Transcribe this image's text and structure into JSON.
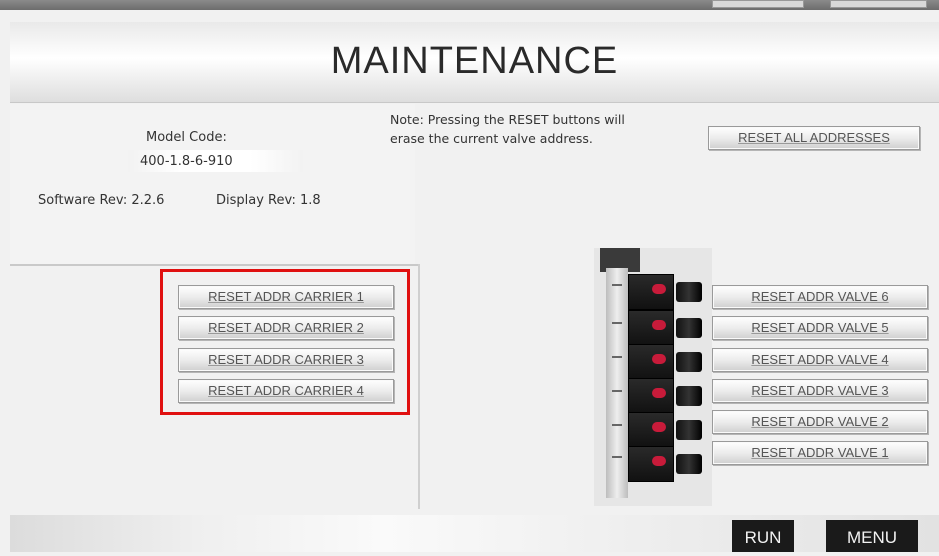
{
  "header": {
    "title": "MAINTENANCE"
  },
  "info": {
    "model_code_label": "Model Code:",
    "model_code_value": "400-1.8-6-910",
    "software_rev": "Software Rev: 2.2.6",
    "display_rev": "Display Rev: 1.8"
  },
  "note": {
    "line1": "Note: Pressing the RESET buttons will",
    "line2": "erase the current valve address."
  },
  "reset_all_label": "RESET ALL ADDRESSES",
  "carrier_buttons": [
    "RESET ADDR CARRIER 1",
    "RESET ADDR CARRIER 2",
    "RESET ADDR CARRIER 3",
    "RESET ADDR CARRIER 4"
  ],
  "valve_buttons": [
    "RESET ADDR VALVE 6",
    "RESET ADDR VALVE 5",
    "RESET ADDR VALVE 4",
    "RESET ADDR VALVE 3",
    "RESET ADDR VALVE 2",
    "RESET ADDR VALVE 1"
  ],
  "footer": {
    "run_label": "RUN",
    "menu_label": "MENU"
  },
  "colors": {
    "highlight": "#e01010",
    "dark_button": "#1a1a1a",
    "valve_led": "#c81b3a"
  }
}
